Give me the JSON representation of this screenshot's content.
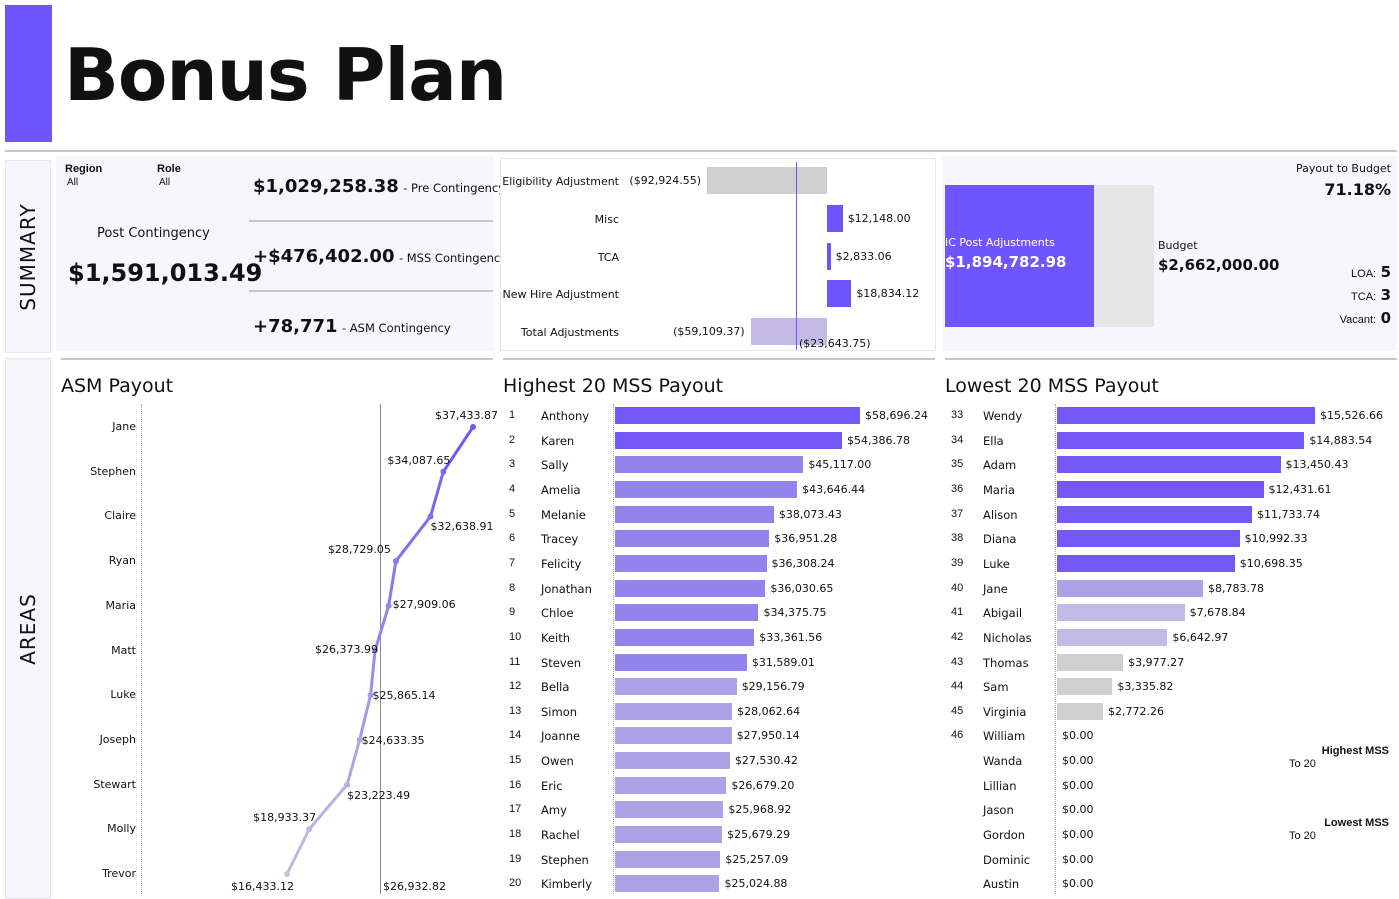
{
  "header": {
    "title": "Bonus Plan"
  },
  "side_labels": {
    "summary": "SUMMARY",
    "areas": "AREAS"
  },
  "filters": {
    "region_label": "Region",
    "region_value": "All",
    "role_label": "Role",
    "role_value": "All"
  },
  "summary": {
    "post_label": "Post Contingency",
    "post_value": "$1,591,013.49",
    "pre_value": "$1,029,258.38",
    "pre_label": "- Pre Contingency",
    "mss_value": "+$476,402.00",
    "mss_label": "- MSS Contingency",
    "asm_value": "+78,771",
    "asm_label": "- ASM Contingency"
  },
  "adjustments": {
    "rows": [
      {
        "label": "Eligibility Adjustment",
        "value": "($92,924.55)",
        "amount": -92924.55
      },
      {
        "label": "Misc",
        "value": "$12,148.00",
        "amount": 12148.0
      },
      {
        "label": "TCA",
        "value": "$2,833.06",
        "amount": 2833.06
      },
      {
        "label": "New Hire Adjustment",
        "value": "$18,834.12",
        "amount": 18834.12
      },
      {
        "label": "Total Adjustments",
        "value": "($59,109.37)",
        "amount": -59109.37
      }
    ],
    "reference_value": "($23,643.75)"
  },
  "budget": {
    "ic_label": "IC Post Adjustments",
    "ic_value": "$1,894,782.98",
    "budget_label": "Budget",
    "budget_value": "$2,662,000.00",
    "payout_label": "Payout to Budget",
    "payout_value": "71.18%",
    "payout_fraction": 0.7118,
    "loa_label": "LOA:",
    "loa_value": "5",
    "tca_label": "TCA:",
    "tca_value": "3",
    "vacant_label": "Vacant:",
    "vacant_value": "0"
  },
  "asm": {
    "title": "ASM Payout",
    "avg_label": "$26,932.82",
    "rows": [
      {
        "name": "Jane",
        "value": 37433.87,
        "label": "$37,433.87"
      },
      {
        "name": "Stephen",
        "value": 34087.65,
        "label": "$34,087.65"
      },
      {
        "name": "Claire",
        "value": 32638.91,
        "label": "$32,638.91"
      },
      {
        "name": "Ryan",
        "value": 28729.05,
        "label": "$28,729.05"
      },
      {
        "name": "Maria",
        "value": 27909.06,
        "label": "$27,909.06"
      },
      {
        "name": "Matt",
        "value": 26373.99,
        "label": "$26,373.99"
      },
      {
        "name": "Luke",
        "value": 25865.14,
        "label": "$25,865.14"
      },
      {
        "name": "Joseph",
        "value": 24633.35,
        "label": "$24,633.35"
      },
      {
        "name": "Stewart",
        "value": 23223.49,
        "label": "$23,223.49"
      },
      {
        "name": "Molly",
        "value": 18933.37,
        "label": "$18,933.37"
      },
      {
        "name": "Trevor",
        "value": 16433.12,
        "label": "$16,433.12"
      }
    ]
  },
  "highest": {
    "title": "Highest 20 MSS Payout",
    "rows": [
      {
        "rank": "1",
        "name": "Anthony",
        "value": 58696.24,
        "label": "$58,696.24"
      },
      {
        "rank": "2",
        "name": "Karen",
        "value": 54386.78,
        "label": "$54,386.78"
      },
      {
        "rank": "3",
        "name": "Sally",
        "value": 45117.0,
        "label": "$45,117.00"
      },
      {
        "rank": "4",
        "name": "Amelia",
        "value": 43646.44,
        "label": "$43,646.44"
      },
      {
        "rank": "5",
        "name": "Melanie",
        "value": 38073.43,
        "label": "$38,073.43"
      },
      {
        "rank": "6",
        "name": "Tracey",
        "value": 36951.28,
        "label": "$36,951.28"
      },
      {
        "rank": "7",
        "name": "Felicity",
        "value": 36308.24,
        "label": "$36,308.24"
      },
      {
        "rank": "8",
        "name": "Jonathan",
        "value": 36030.65,
        "label": "$36,030.65"
      },
      {
        "rank": "9",
        "name": "Chloe",
        "value": 34375.75,
        "label": "$34,375.75"
      },
      {
        "rank": "10",
        "name": "Keith",
        "value": 33361.56,
        "label": "$33,361.56"
      },
      {
        "rank": "11",
        "name": "Steven",
        "value": 31589.01,
        "label": "$31,589.01"
      },
      {
        "rank": "12",
        "name": "Bella",
        "value": 29156.79,
        "label": "$29,156.79"
      },
      {
        "rank": "13",
        "name": "Simon",
        "value": 28062.64,
        "label": "$28,062.64"
      },
      {
        "rank": "14",
        "name": "Joanne",
        "value": 27950.14,
        "label": "$27,950.14"
      },
      {
        "rank": "15",
        "name": "Owen",
        "value": 27530.42,
        "label": "$27,530.42"
      },
      {
        "rank": "16",
        "name": "Eric",
        "value": 26679.2,
        "label": "$26,679.20"
      },
      {
        "rank": "17",
        "name": "Amy",
        "value": 25968.92,
        "label": "$25,968.92"
      },
      {
        "rank": "18",
        "name": "Rachel",
        "value": 25679.29,
        "label": "$25,679.29"
      },
      {
        "rank": "19",
        "name": "Stephen",
        "value": 25257.09,
        "label": "$25,257.09"
      },
      {
        "rank": "20",
        "name": "Kimberly",
        "value": 25024.88,
        "label": "$25,024.88"
      }
    ]
  },
  "lowest": {
    "title": "Lowest 20 MSS Payout",
    "rows": [
      {
        "rank": "33",
        "name": "Wendy",
        "value": 15526.66,
        "label": "$15,526.66"
      },
      {
        "rank": "34",
        "name": "Ella",
        "value": 14883.54,
        "label": "$14,883.54"
      },
      {
        "rank": "35",
        "name": "Adam",
        "value": 13450.43,
        "label": "$13,450.43"
      },
      {
        "rank": "36",
        "name": "Maria",
        "value": 12431.61,
        "label": "$12,431.61"
      },
      {
        "rank": "37",
        "name": "Alison",
        "value": 11733.74,
        "label": "$11,733.74"
      },
      {
        "rank": "38",
        "name": "Diana",
        "value": 10992.33,
        "label": "$10,992.33"
      },
      {
        "rank": "39",
        "name": "Luke",
        "value": 10698.35,
        "label": "$10,698.35"
      },
      {
        "rank": "40",
        "name": "Jane",
        "value": 8783.78,
        "label": "$8,783.78"
      },
      {
        "rank": "41",
        "name": "Abigail",
        "value": 7678.84,
        "label": "$7,678.84"
      },
      {
        "rank": "42",
        "name": "Nicholas",
        "value": 6642.97,
        "label": "$6,642.97"
      },
      {
        "rank": "43",
        "name": "Thomas",
        "value": 3977.27,
        "label": "$3,977.27"
      },
      {
        "rank": "44",
        "name": "Sam",
        "value": 3335.82,
        "label": "$3,335.82"
      },
      {
        "rank": "45",
        "name": "Virginia",
        "value": 2772.26,
        "label": "$2,772.26"
      },
      {
        "rank": "46",
        "name": "William",
        "value": 0,
        "label": "$0.00"
      },
      {
        "rank": "",
        "name": "Wanda",
        "value": 0,
        "label": "$0.00"
      },
      {
        "rank": "",
        "name": "Lillian",
        "value": 0,
        "label": "$0.00"
      },
      {
        "rank": "",
        "name": "Jason",
        "value": 0,
        "label": "$0.00"
      },
      {
        "rank": "",
        "name": "Gordon",
        "value": 0,
        "label": "$0.00"
      },
      {
        "rank": "",
        "name": "Dominic",
        "value": 0,
        "label": "$0.00"
      },
      {
        "rank": "",
        "name": "Austin",
        "value": 0,
        "label": "$0.00"
      }
    ]
  },
  "legend": {
    "highest_label": "Highest MSS",
    "highest_sub": "To 20",
    "lowest_label": "Lowest MSS",
    "lowest_sub": "To 20"
  },
  "colors": {
    "accent": "#6f55ff",
    "dark": "#7458f6",
    "mid": "#9383ec",
    "light": "#ada2e6",
    "pale": "#c3bbe6",
    "grey": "#cfcfcf",
    "budget_bg": "#e5e5e5"
  },
  "chart_data": [
    {
      "type": "bar",
      "title": "",
      "categories": [
        "Eligibility Adjustment",
        "Misc",
        "TCA",
        "New Hire Adjustment",
        "Total Adjustments"
      ],
      "values": [
        -92924.55,
        12148.0,
        2833.06,
        18834.12,
        -59109.37
      ]
    },
    {
      "type": "line",
      "title": "ASM Payout",
      "categories": [
        "Jane",
        "Stephen",
        "Claire",
        "Ryan",
        "Maria",
        "Matt",
        "Luke",
        "Joseph",
        "Stewart",
        "Molly",
        "Trevor"
      ],
      "values": [
        37433.87,
        34087.65,
        32638.91,
        28729.05,
        27909.06,
        26373.99,
        25865.14,
        24633.35,
        23223.49,
        18933.37,
        16433.12
      ],
      "reference_line": 26932.82
    },
    {
      "type": "bar",
      "title": "Highest 20 MSS Payout",
      "categories": [
        "Anthony",
        "Karen",
        "Sally",
        "Amelia",
        "Melanie",
        "Tracey",
        "Felicity",
        "Jonathan",
        "Chloe",
        "Keith",
        "Steven",
        "Bella",
        "Simon",
        "Joanne",
        "Owen",
        "Eric",
        "Amy",
        "Rachel",
        "Stephen",
        "Kimberly"
      ],
      "values": [
        58696.24,
        54386.78,
        45117.0,
        43646.44,
        38073.43,
        36951.28,
        36308.24,
        36030.65,
        34375.75,
        33361.56,
        31589.01,
        29156.79,
        28062.64,
        27950.14,
        27530.42,
        26679.2,
        25968.92,
        25679.29,
        25257.09,
        25024.88
      ]
    },
    {
      "type": "bar",
      "title": "Lowest 20 MSS Payout",
      "categories": [
        "Wendy",
        "Ella",
        "Adam",
        "Maria",
        "Alison",
        "Diana",
        "Luke",
        "Jane",
        "Abigail",
        "Nicholas",
        "Thomas",
        "Sam",
        "Virginia",
        "William",
        "Wanda",
        "Lillian",
        "Jason",
        "Gordon",
        "Dominic",
        "Austin"
      ],
      "values": [
        15526.66,
        14883.54,
        13450.43,
        12431.61,
        11733.74,
        10992.33,
        10698.35,
        8783.78,
        7678.84,
        6642.97,
        3977.27,
        3335.82,
        2772.26,
        0,
        0,
        0,
        0,
        0,
        0,
        0
      ]
    }
  ]
}
